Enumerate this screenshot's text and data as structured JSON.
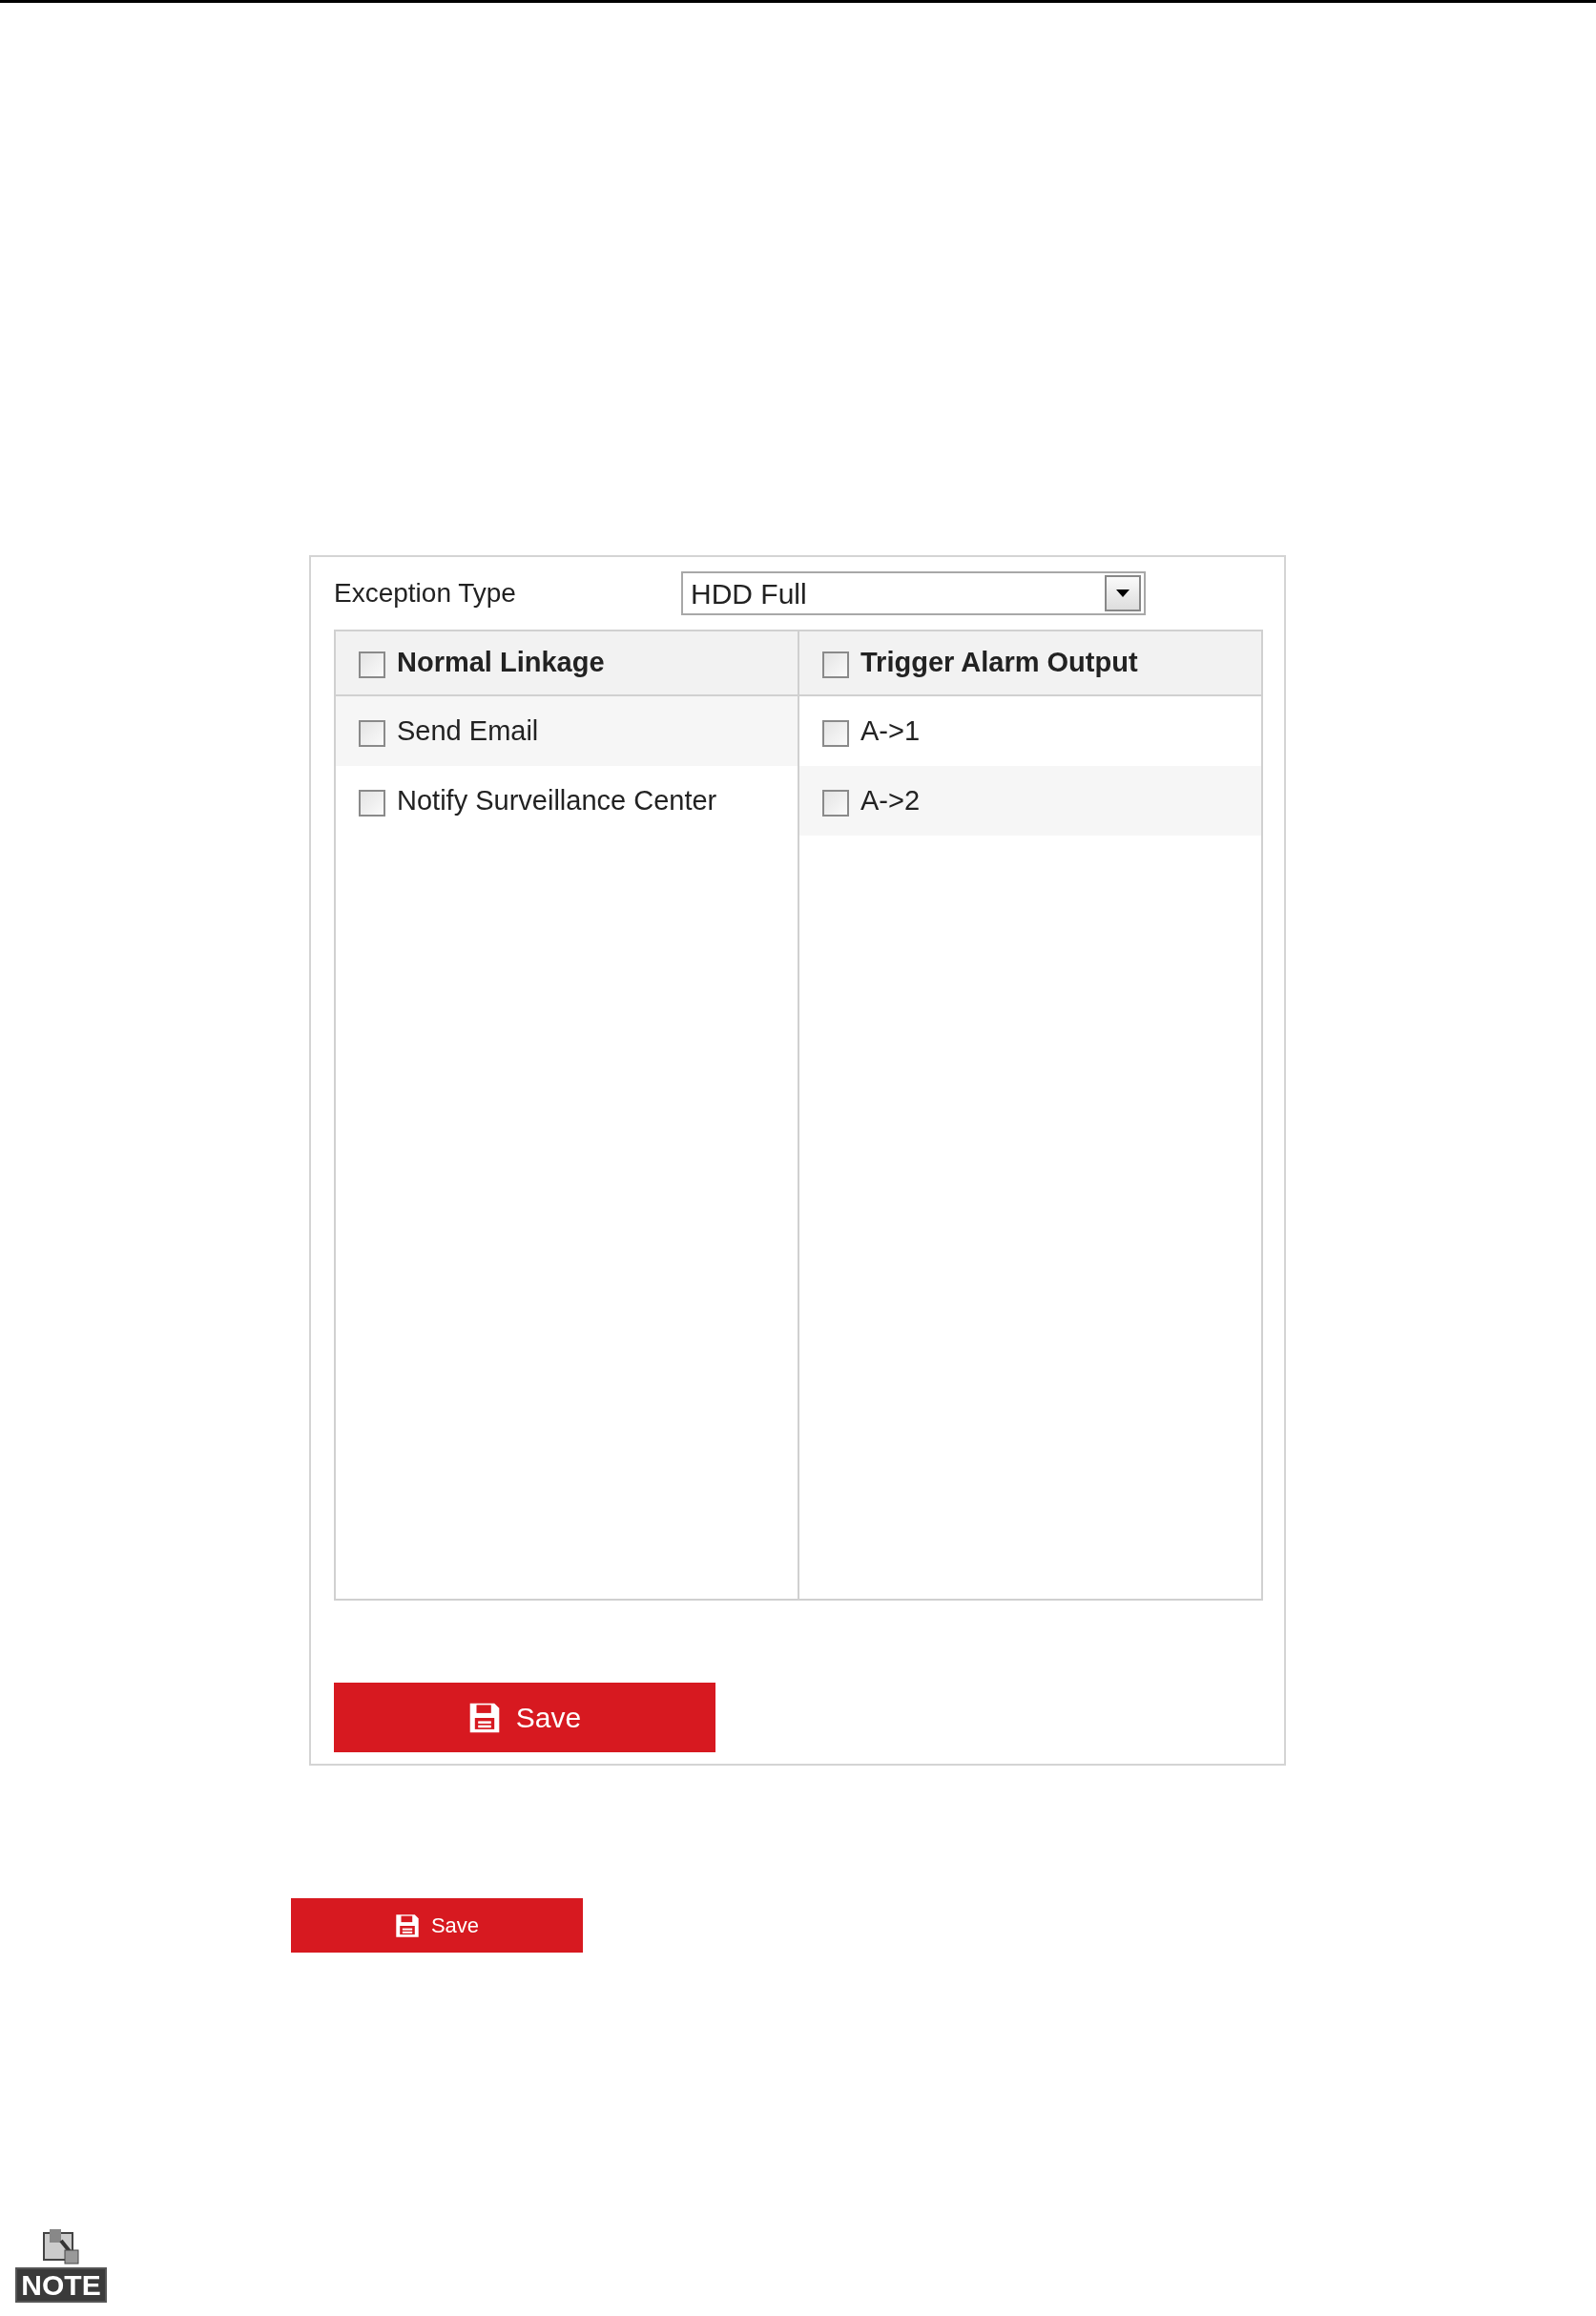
{
  "exception_type": {
    "label": "Exception Type",
    "value": "HDD Full"
  },
  "linkage_columns": [
    {
      "header": "Normal Linkage",
      "checked": false,
      "items": [
        {
          "label": "Send Email",
          "checked": false
        },
        {
          "label": "Notify Surveillance Center",
          "checked": false
        }
      ]
    },
    {
      "header": "Trigger Alarm Output",
      "checked": false,
      "items": [
        {
          "label": "A->1",
          "checked": false
        },
        {
          "label": "A->2",
          "checked": false
        }
      ]
    }
  ],
  "save_button": {
    "label": "Save"
  },
  "standalone_save_button": {
    "label": "Save"
  },
  "note": {
    "label": "NOTE"
  }
}
